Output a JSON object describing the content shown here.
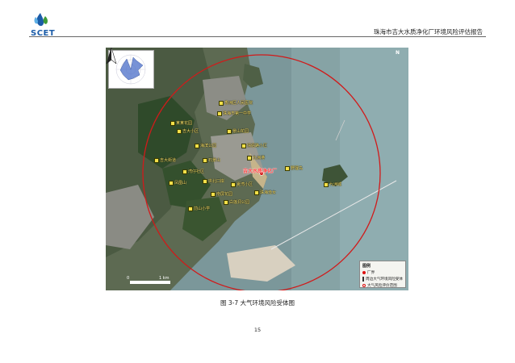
{
  "header": {
    "logo_text": "SCET",
    "report_title": "珠海市吉大水质净化厂环境风险评估报告"
  },
  "figure": {
    "plant_label": "吉大水质净化厂",
    "north_label": "N",
    "scale_start": "0",
    "scale_end": "1 km",
    "sensitive_sites": [
      "香洲区人民医院",
      "珠海市第一中学",
      "某某花园",
      "吉大小区",
      "景山花园",
      "海滨公园",
      "情侣路小区",
      "吉大街道",
      "石景山",
      "九洲港",
      "野狸岛",
      "湾仔社区",
      "拱北口岸",
      "夏湾小区",
      "南屏花园",
      "前山小学",
      "白莲洞公园",
      "凤凰山",
      "九洲城",
      "珠海渔女"
    ],
    "legend": {
      "title": "图例",
      "plant": "厂界",
      "sites": "周边大气环境风险受体",
      "range": "大气风险评价范围"
    },
    "caption": "图 3-7 大气环境风险受体图"
  },
  "page_number": "15"
}
